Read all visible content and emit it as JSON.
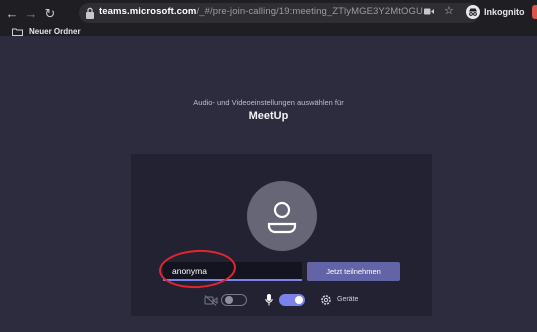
{
  "browser": {
    "url_host": "teams.microsoft.com",
    "url_path": "/_#/pre-join-calling/19:meeting_ZTlyMGE3Y2MtOGU...",
    "profile_label": "Inkognito",
    "bookmark_label": "Neuer Ordner",
    "icons": [
      "back-icon",
      "forward-icon",
      "reload-icon",
      "lock-icon",
      "camera-icon",
      "star-icon",
      "incognito-icon",
      "folder-icon"
    ]
  },
  "prejoin": {
    "subtitle": "Audio- und Videoeinstellungen auswählen für",
    "meeting_title": "MeetUp",
    "name_value": "anonyma",
    "join_label": "Jetzt teilnehmen",
    "video_enabled": false,
    "mic_enabled": true,
    "devices_label": "Geräte"
  },
  "colors": {
    "page_bg": "#2d2c3e",
    "panel_bg": "#222232",
    "accent": "#6264a7",
    "toggle_on": "#7b83eb",
    "annotation": "#e3262d"
  }
}
